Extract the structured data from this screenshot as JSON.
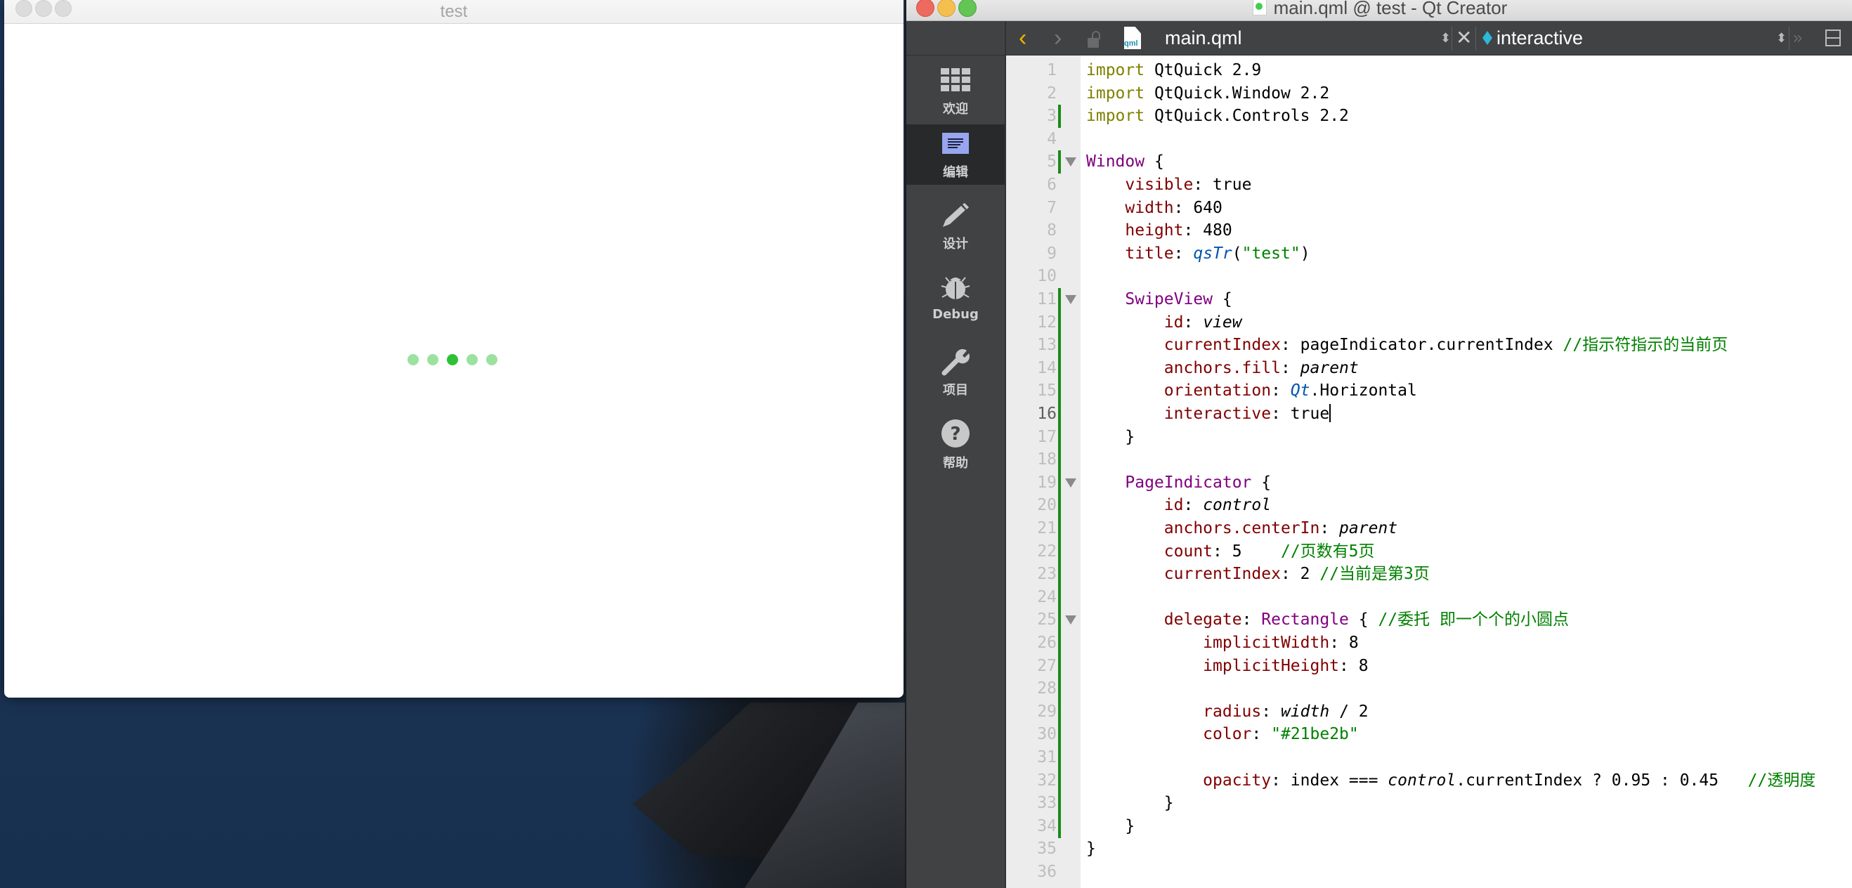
{
  "app_window": {
    "title": "test",
    "page_indicator": {
      "count": 5,
      "current_index": 2,
      "color": "#21be2b",
      "active_opacity": 0.95,
      "inactive_opacity": 0.45
    }
  },
  "qt_creator": {
    "window_title": "main.qml @ test - Qt Creator",
    "toolbar": {
      "back_glyph": "‹",
      "forward_glyph": "›",
      "file_icon_text": "qml",
      "file_name": "main.qml",
      "updown_glyph": "⬍",
      "close_glyph": "✕",
      "symbol_name": "interactive",
      "more_glyph": "»"
    },
    "modes": [
      {
        "label": "欢迎",
        "icon": "grid-icon",
        "active": false
      },
      {
        "label": "编辑",
        "icon": "edit-document-icon",
        "active": true
      },
      {
        "label": "设计",
        "icon": "pencil-icon",
        "active": false
      },
      {
        "label": "Debug",
        "icon": "bug-icon",
        "active": false
      },
      {
        "label": "项目",
        "icon": "wrench-icon",
        "active": false
      },
      {
        "label": "帮助",
        "icon": "help-icon",
        "active": false
      }
    ],
    "editor": {
      "current_line": 16,
      "lines": [
        {
          "n": "1",
          "t": [
            [
              "kw",
              "import"
            ],
            [
              "",
              " QtQuick 2.9"
            ]
          ]
        },
        {
          "n": "2",
          "t": [
            [
              "kw",
              "import"
            ],
            [
              "",
              " QtQuick.Window 2.2"
            ]
          ]
        },
        {
          "n": "3",
          "t": [
            [
              "kw",
              "import"
            ],
            [
              "",
              " QtQuick.Controls 2.2"
            ]
          ]
        },
        {
          "n": "4",
          "t": []
        },
        {
          "n": "5",
          "t": [
            [
              "ty",
              "Window"
            ],
            [
              "",
              " {"
            ]
          ]
        },
        {
          "n": "6",
          "t": [
            [
              "",
              "    "
            ],
            [
              "pr",
              "visible"
            ],
            [
              "",
              ": true"
            ]
          ]
        },
        {
          "n": "7",
          "t": [
            [
              "",
              "    "
            ],
            [
              "pr",
              "width"
            ],
            [
              "",
              ": 640"
            ]
          ]
        },
        {
          "n": "8",
          "t": [
            [
              "",
              "    "
            ],
            [
              "pr",
              "height"
            ],
            [
              "",
              ": 480"
            ]
          ]
        },
        {
          "n": "9",
          "t": [
            [
              "",
              "    "
            ],
            [
              "pr",
              "title"
            ],
            [
              "",
              ": "
            ],
            [
              "fn",
              "qsTr"
            ],
            [
              "",
              "("
            ],
            [
              "st",
              "\"test\""
            ],
            [
              "",
              ")"
            ]
          ]
        },
        {
          "n": "10",
          "t": []
        },
        {
          "n": "11",
          "t": [
            [
              "",
              "    "
            ],
            [
              "ty",
              "SwipeView"
            ],
            [
              "",
              " {"
            ]
          ]
        },
        {
          "n": "12",
          "t": [
            [
              "",
              "        "
            ],
            [
              "pr",
              "id"
            ],
            [
              "",
              ": "
            ],
            [
              "it",
              "view"
            ]
          ]
        },
        {
          "n": "13",
          "t": [
            [
              "",
              "        "
            ],
            [
              "pr",
              "currentIndex"
            ],
            [
              "",
              ": pageIndicator.currentIndex "
            ],
            [
              "cm",
              "//指示符指示的当前页"
            ]
          ]
        },
        {
          "n": "14",
          "t": [
            [
              "",
              "        "
            ],
            [
              "pr",
              "anchors.fill"
            ],
            [
              "",
              ": "
            ],
            [
              "it",
              "parent"
            ]
          ]
        },
        {
          "n": "15",
          "t": [
            [
              "",
              "        "
            ],
            [
              "pr",
              "orientation"
            ],
            [
              "",
              ": "
            ],
            [
              "fn",
              "Qt"
            ],
            [
              "",
              ".Horizontal"
            ]
          ]
        },
        {
          "n": "16",
          "t": [
            [
              "",
              "        "
            ],
            [
              "pr",
              "interactive"
            ],
            [
              "",
              ": true"
            ]
          ]
        },
        {
          "n": "17",
          "t": [
            [
              "",
              "    }"
            ]
          ]
        },
        {
          "n": "18",
          "t": []
        },
        {
          "n": "19",
          "t": [
            [
              "",
              "    "
            ],
            [
              "ty",
              "PageIndicator"
            ],
            [
              "",
              " {"
            ]
          ]
        },
        {
          "n": "20",
          "t": [
            [
              "",
              "        "
            ],
            [
              "pr",
              "id"
            ],
            [
              "",
              ": "
            ],
            [
              "it",
              "control"
            ]
          ]
        },
        {
          "n": "21",
          "t": [
            [
              "",
              "        "
            ],
            [
              "pr",
              "anchors.centerIn"
            ],
            [
              "",
              ": "
            ],
            [
              "it",
              "parent"
            ]
          ]
        },
        {
          "n": "22",
          "t": [
            [
              "",
              "        "
            ],
            [
              "pr",
              "count"
            ],
            [
              "",
              ": 5    "
            ],
            [
              "cm",
              "//页数有5页"
            ]
          ]
        },
        {
          "n": "23",
          "t": [
            [
              "",
              "        "
            ],
            [
              "pr",
              "currentIndex"
            ],
            [
              "",
              ": 2 "
            ],
            [
              "cm",
              "//当前是第3页"
            ]
          ]
        },
        {
          "n": "24",
          "t": []
        },
        {
          "n": "25",
          "t": [
            [
              "",
              "        "
            ],
            [
              "pr",
              "delegate"
            ],
            [
              "",
              ": "
            ],
            [
              "ty",
              "Rectangle"
            ],
            [
              "",
              " { "
            ],
            [
              "cm",
              "//委托 即一个个的小圆点"
            ]
          ]
        },
        {
          "n": "26",
          "t": [
            [
              "",
              "            "
            ],
            [
              "pr",
              "implicitWidth"
            ],
            [
              "",
              ": 8"
            ]
          ]
        },
        {
          "n": "27",
          "t": [
            [
              "",
              "            "
            ],
            [
              "pr",
              "implicitHeight"
            ],
            [
              "",
              ": 8"
            ]
          ]
        },
        {
          "n": "28",
          "t": []
        },
        {
          "n": "29",
          "t": [
            [
              "",
              "            "
            ],
            [
              "pr",
              "radius"
            ],
            [
              "",
              ": "
            ],
            [
              "it",
              "width"
            ],
            [
              "",
              " / 2"
            ]
          ]
        },
        {
          "n": "30",
          "t": [
            [
              "",
              "            "
            ],
            [
              "pr",
              "color"
            ],
            [
              "",
              ": "
            ],
            [
              "st",
              "\"#21be2b\""
            ]
          ]
        },
        {
          "n": "31",
          "t": []
        },
        {
          "n": "32",
          "t": [
            [
              "",
              "            "
            ],
            [
              "pr",
              "opacity"
            ],
            [
              "",
              ": index === "
            ],
            [
              "it",
              "control"
            ],
            [
              "",
              ".currentIndex ? 0.95 : 0.45   "
            ],
            [
              "cm",
              "//透明度"
            ]
          ]
        },
        {
          "n": "33",
          "t": [
            [
              "",
              "        }"
            ]
          ]
        },
        {
          "n": "34",
          "t": [
            [
              "",
              "    }"
            ]
          ]
        },
        {
          "n": "35",
          "t": [
            [
              "",
              "}"
            ]
          ]
        },
        {
          "n": "36",
          "t": []
        }
      ],
      "fold_lines": [
        5,
        11,
        19,
        25
      ],
      "changed_lines": [
        3,
        5,
        11,
        12,
        13,
        14,
        15,
        16,
        17,
        18,
        19,
        20,
        21,
        22,
        23,
        24,
        25,
        26,
        27,
        28,
        29,
        30,
        31,
        32,
        33,
        34
      ]
    }
  }
}
